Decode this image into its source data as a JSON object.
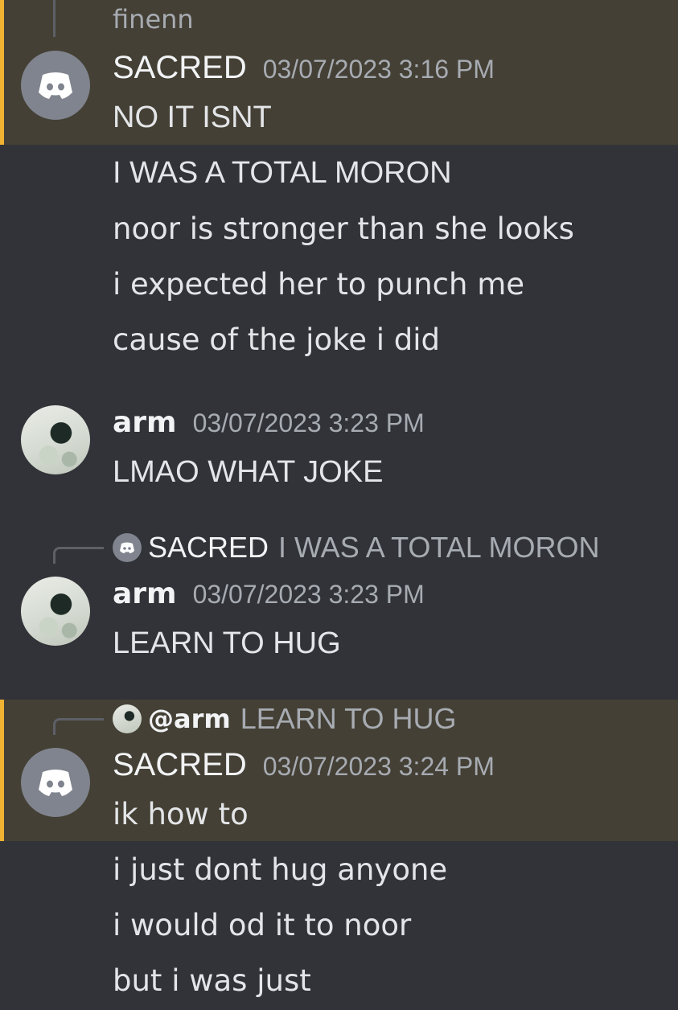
{
  "top_partial": {
    "name": "finenn"
  },
  "messages": [
    {
      "author": "SACRED",
      "timestamp": "03/07/2023 3:16 PM",
      "avatar_icon": "discord-logo-icon",
      "highlighted": true,
      "lines": [
        "NO IT ISNT",
        "I WAS A TOTAL MORON",
        "noor is stronger than she looks",
        "i expected her to punch me",
        "cause of the joke i did"
      ]
    },
    {
      "author": "arm",
      "timestamp": "03/07/2023 3:23 PM",
      "avatar_icon": "user-photo-avatar",
      "lines": [
        "LMAO WHAT JOKE"
      ]
    },
    {
      "reply": {
        "author": "SACRED",
        "text": "I WAS A TOTAL MORON",
        "icon": "discord-logo-icon"
      },
      "author": "arm",
      "timestamp": "03/07/2023 3:23 PM",
      "avatar_icon": "user-photo-avatar",
      "lines": [
        "LEARN TO HUG"
      ]
    },
    {
      "reply": {
        "author": "@arm",
        "text": "LEARN TO HUG",
        "icon": "user-photo-avatar"
      },
      "author": "SACRED",
      "timestamp": "03/07/2023 3:24 PM",
      "avatar_icon": "discord-logo-icon",
      "highlighted": true,
      "lines": [
        "ik how to",
        "i just dont hug anyone",
        "i would od it to noor",
        "but i was just"
      ]
    }
  ],
  "colors": {
    "background": "#313338",
    "mention_highlight": "#444035",
    "mention_bar": "#f0b232",
    "username": "#f2f3f5",
    "timestamp": "#a7abb2",
    "text": "#e3e5e8"
  }
}
